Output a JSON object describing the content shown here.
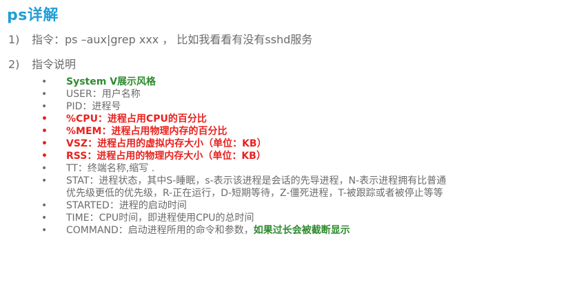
{
  "title": "ps详解",
  "items": [
    {
      "num": "1)",
      "text": "指令：ps –aux|grep xxx ， 比如我看看有没有sshd服务"
    },
    {
      "num": "2)",
      "text": "指令说明"
    }
  ],
  "bullet_symbol": "•",
  "bullets": [
    {
      "text": "System V展示风格"
    },
    {
      "text": "USER：用户名称"
    },
    {
      "text": "PID：进程号"
    },
    {
      "text": "%CPU：进程占用CPU的百分比"
    },
    {
      "text": "%MEM：进程占用物理内存的百分比"
    },
    {
      "text": "VSZ：进程占用的虚拟内存大小（单位：KB）"
    },
    {
      "text": "RSS：进程占用的物理内存大小（单位：KB）"
    },
    {
      "text": "TT：终端名称,缩写 ."
    },
    {
      "line1": "STAT：进程状态，其中S-睡眠，s-表示该进程是会话的先导进程，N-表示进程拥有比普通",
      "line2": "优先级更低的优先级，R-正在运行，D-短期等待，Z-僵死进程，T-被跟踪或者被停止等等"
    },
    {
      "text": "STARTED：进程的启动时间"
    },
    {
      "text": "TIME：CPU时间，即进程使用CPU的总时间"
    },
    {
      "text_plain": "COMMAND：启动进程所用的命令和参数，",
      "text_bold": "如果过长会被截断显示"
    }
  ]
}
